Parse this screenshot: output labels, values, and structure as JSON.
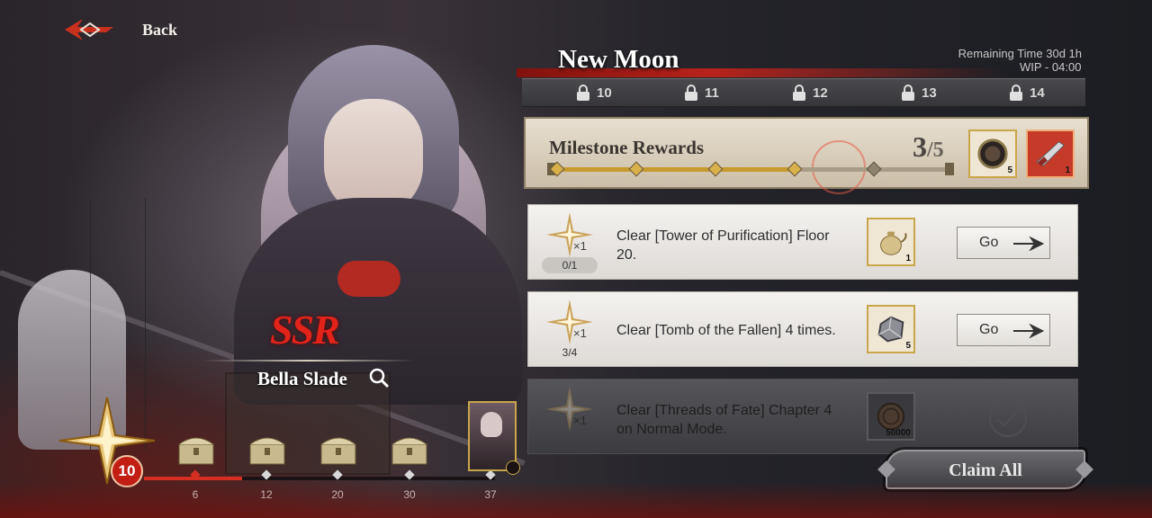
{
  "nav": {
    "back_label": "Back"
  },
  "character": {
    "rarity": "SSR",
    "name": "Bella Slade"
  },
  "progress_track": {
    "level": "10",
    "fill_fraction": 0.28,
    "milestones": [
      "6",
      "12",
      "20",
      "30",
      "37"
    ]
  },
  "event": {
    "title": "New Moon",
    "remaining_label": "Remaining Time",
    "remaining_value": "30d 1h",
    "wip_label": "WIP -",
    "wip_value": "04:00",
    "days": [
      "10",
      "11",
      "12",
      "13",
      "14"
    ]
  },
  "milestone": {
    "title": "Milestone Rewards",
    "current": "3",
    "total": "/5",
    "nodes_reached": 4,
    "nodes_total": 5,
    "rewards": [
      {
        "icon": "mirror-icon",
        "qty": "5"
      },
      {
        "icon": "weapon-icon",
        "qty": "1"
      }
    ]
  },
  "tasks": [
    {
      "star_qty": "×1",
      "progress": "0/1",
      "description": "Clear [Tower of Purification] Floor 20.",
      "reward_icon": "teapot-icon",
      "reward_qty": "1",
      "action": "Go",
      "state": "active"
    },
    {
      "star_qty": "×1",
      "progress": "3/4",
      "description": "Clear [Tomb of the Fallen] 4 times.",
      "reward_icon": "ore-icon",
      "reward_qty": "5",
      "action": "Go",
      "state": "active"
    },
    {
      "star_qty": "×1",
      "progress": "",
      "description": "Clear [Threads of Fate] Chapter 4 on Normal Mode.",
      "reward_icon": "coin-icon",
      "reward_qty": "50000",
      "action": "",
      "state": "completed"
    }
  ],
  "claim_all_label": "Claim All",
  "colors": {
    "accent_red": "#d42f22",
    "gold": "#c9a64a",
    "panel_light": "#f4f2ef"
  }
}
